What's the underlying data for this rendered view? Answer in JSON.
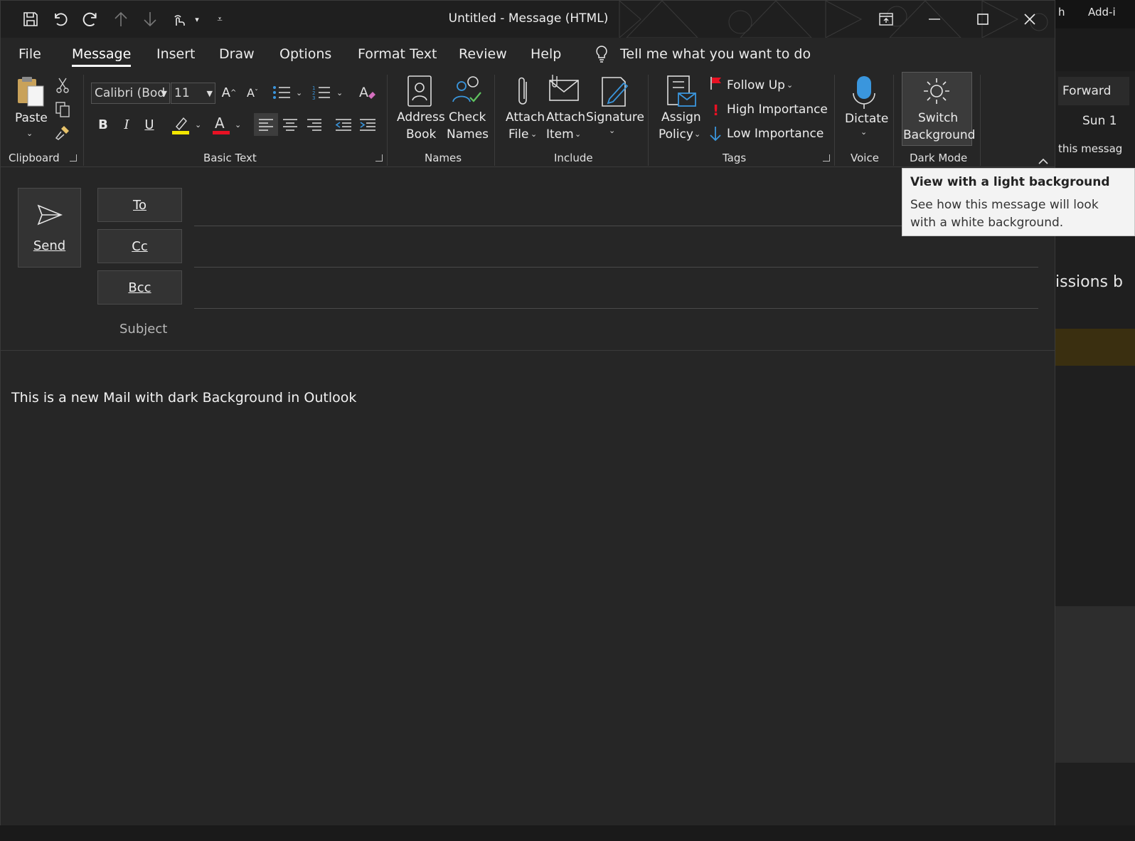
{
  "window": {
    "title": "Untitled  -  Message (HTML)"
  },
  "background_window": {
    "tab_fragment_1": "h",
    "tab_fragment_2": "Add-i",
    "forward_label": "Forward",
    "date_fragment": "Sun 1",
    "message_fragment": "this messag",
    "heading_fragment": "issions b"
  },
  "menu": {
    "items": [
      "File",
      "Message",
      "Insert",
      "Draw",
      "Options",
      "Format Text",
      "Review",
      "Help"
    ],
    "active": "Message",
    "tell_me": "Tell me what you want to do"
  },
  "ribbon": {
    "clipboard": {
      "label": "Clipboard",
      "paste": "Paste"
    },
    "basic_text": {
      "label": "Basic Text",
      "font_name": "Calibri (Bod",
      "font_size": "11",
      "highlight_color": "#f2e600",
      "font_color": "#e81123"
    },
    "names": {
      "label": "Names",
      "address_book": [
        "Address",
        "Book"
      ],
      "check_names": [
        "Check",
        "Names"
      ]
    },
    "include": {
      "label": "Include",
      "attach_file": [
        "Attach",
        "File"
      ],
      "attach_item": [
        "Attach",
        "Item"
      ],
      "signature": "Signature"
    },
    "tags": {
      "label": "Tags",
      "assign_policy": [
        "Assign",
        "Policy"
      ],
      "follow_up": "Follow Up",
      "high_importance": "High Importance",
      "low_importance": "Low Importance"
    },
    "voice": {
      "label": "Voice",
      "dictate": "Dictate"
    },
    "dark_mode": {
      "label": "Dark Mode",
      "switch_background": [
        "Switch",
        "Background"
      ]
    }
  },
  "tooltip": {
    "title": "View with a light background",
    "body": "See how this message will look with a white background."
  },
  "compose": {
    "send": "Send",
    "to": "To",
    "cc": "Cc",
    "bcc": "Bcc",
    "subject": "Subject",
    "body": "This is a new Mail with dark Background in Outlook"
  },
  "colors": {
    "accent_blue": "#3a96dd",
    "flag_red": "#e81123"
  }
}
